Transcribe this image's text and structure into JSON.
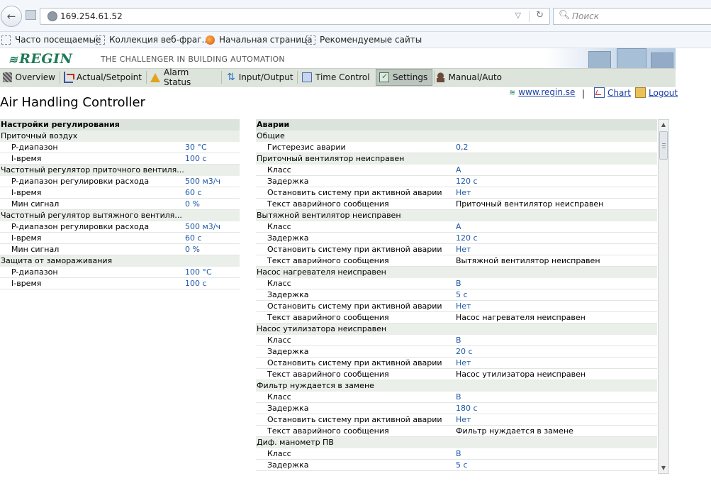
{
  "browser": {
    "url": "169.254.61.52",
    "search_placeholder": "Поиск",
    "bookmarks": [
      "Часто посещаемые",
      "Коллекция веб-фраг...",
      "Начальная страница",
      "Рекомендуемые сайты"
    ]
  },
  "banner": {
    "logo": "REGIN",
    "tagline": "THE CHALLENGER IN BUILDING AUTOMATION"
  },
  "tabs": [
    {
      "label": "Overview",
      "active": false
    },
    {
      "label": "Actual/Setpoint",
      "active": false
    },
    {
      "label": "Alarm Status",
      "active": false
    },
    {
      "label": "Input/Output",
      "active": false
    },
    {
      "label": "Time Control",
      "active": false
    },
    {
      "label": "Settings",
      "active": true
    },
    {
      "label": "Manual/Auto",
      "active": false
    }
  ],
  "page": {
    "title": "Air Handling Controller",
    "links": {
      "site": "www.regin.se",
      "separator": "|",
      "chart": "Chart",
      "logout": "Logout"
    }
  },
  "left_table": {
    "header": "Настройки регулирования",
    "rows": [
      {
        "type": "sec",
        "label": "Приточный воздух"
      },
      {
        "type": "item",
        "label": "P-диапазон",
        "value": "30 °C"
      },
      {
        "type": "item",
        "label": "I-время",
        "value": "100 с"
      },
      {
        "type": "sec",
        "label": "Частотный регулятор приточного вентиля..."
      },
      {
        "type": "item",
        "label": "P-диапазон регулировки расхода",
        "value": "500 м3/ч"
      },
      {
        "type": "item",
        "label": "I-время",
        "value": "60 с"
      },
      {
        "type": "item",
        "label": "Мин сигнал",
        "value": "0 %"
      },
      {
        "type": "sec",
        "label": "Частотный регулятор вытяжного вентиля..."
      },
      {
        "type": "item",
        "label": "P-диапазон регулировки расхода",
        "value": "500 м3/ч"
      },
      {
        "type": "item",
        "label": "I-время",
        "value": "60 с"
      },
      {
        "type": "item",
        "label": "Мин сигнал",
        "value": "0 %"
      },
      {
        "type": "sec",
        "label": "Защита от замораживания"
      },
      {
        "type": "item",
        "label": "P-диапазон",
        "value": "100 °C"
      },
      {
        "type": "item",
        "label": "I-время",
        "value": "100 с"
      }
    ]
  },
  "right_table": {
    "header": "Аварии",
    "rows": [
      {
        "type": "sec",
        "label": "Общие"
      },
      {
        "type": "item",
        "label": "Гистерезис аварии",
        "value": "0,2"
      },
      {
        "type": "sec",
        "label": "Приточный вентилятор неисправен"
      },
      {
        "type": "item",
        "label": "Класс",
        "value": "A"
      },
      {
        "type": "item",
        "label": "Задержка",
        "value": "120 с"
      },
      {
        "type": "item",
        "label": "Остановить систему при активной аварии",
        "value": "Нет"
      },
      {
        "type": "item",
        "label": "Текст аварийного сообщения",
        "value": "Приточный вентилятор неисправен",
        "plain": true
      },
      {
        "type": "sec",
        "label": "Вытяжной вентилятор неисправен"
      },
      {
        "type": "item",
        "label": "Класс",
        "value": "A"
      },
      {
        "type": "item",
        "label": "Задержка",
        "value": "120 с"
      },
      {
        "type": "item",
        "label": "Остановить систему при активной аварии",
        "value": "Нет"
      },
      {
        "type": "item",
        "label": "Текст аварийного сообщения",
        "value": "Вытяжной вентилятор неисправен",
        "plain": true
      },
      {
        "type": "sec",
        "label": "Насос нагревателя неисправен"
      },
      {
        "type": "item",
        "label": "Класс",
        "value": "B"
      },
      {
        "type": "item",
        "label": "Задержка",
        "value": "5 с"
      },
      {
        "type": "item",
        "label": "Остановить систему при активной аварии",
        "value": "Нет"
      },
      {
        "type": "item",
        "label": "Текст аварийного сообщения",
        "value": "Насос нагревателя неисправен",
        "plain": true
      },
      {
        "type": "sec",
        "label": "Насос утилизатора неисправен"
      },
      {
        "type": "item",
        "label": "Класс",
        "value": "B"
      },
      {
        "type": "item",
        "label": "Задержка",
        "value": "20 с"
      },
      {
        "type": "item",
        "label": "Остановить систему при активной аварии",
        "value": "Нет"
      },
      {
        "type": "item",
        "label": "Текст аварийного сообщения",
        "value": "Насос утилизатора неисправен",
        "plain": true
      },
      {
        "type": "sec",
        "label": "Фильтр нуждается в замене"
      },
      {
        "type": "item",
        "label": "Класс",
        "value": "B"
      },
      {
        "type": "item",
        "label": "Задержка",
        "value": "180 с"
      },
      {
        "type": "item",
        "label": "Остановить систему при активной аварии",
        "value": "Нет"
      },
      {
        "type": "item",
        "label": "Текст аварийного сообщения",
        "value": "Фильтр нуждается в замене",
        "plain": true
      },
      {
        "type": "sec",
        "label": "Диф. манометр ПВ"
      },
      {
        "type": "item",
        "label": "Класс",
        "value": "B"
      },
      {
        "type": "item",
        "label": "Задержка",
        "value": "5 с"
      }
    ]
  },
  "icons": {
    "back": "back-arrow-icon",
    "reload": "reload-icon",
    "search": "search-icon",
    "chart_link": "chart-icon",
    "logout_link": "key-icon"
  }
}
